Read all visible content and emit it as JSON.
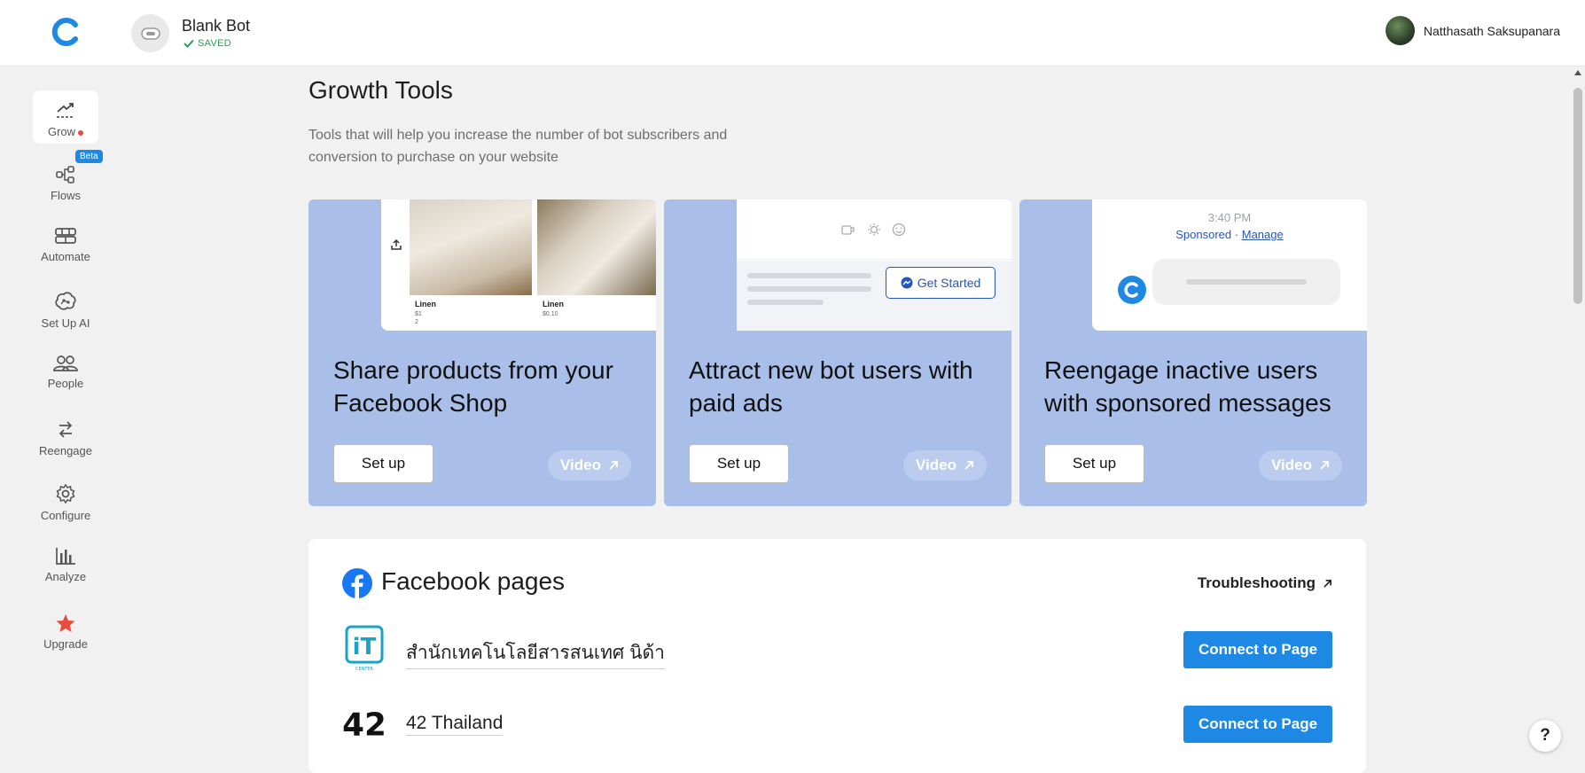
{
  "header": {
    "bot_name": "Blank Bot",
    "bot_status": "SAVED",
    "user_name": "Natthasath Saksupanara"
  },
  "sidebar": {
    "items": [
      {
        "label": "Grow",
        "icon": "trend-icon",
        "active": true
      },
      {
        "label": "Flows",
        "icon": "flows-icon",
        "badge": "Beta"
      },
      {
        "label": "Automate",
        "icon": "automate-icon"
      },
      {
        "label": "Set Up AI",
        "icon": "ai-brain-icon"
      },
      {
        "label": "People",
        "icon": "people-icon"
      },
      {
        "label": "Reengage",
        "icon": "reengage-icon"
      },
      {
        "label": "Configure",
        "icon": "gear-icon"
      },
      {
        "label": "Analyze",
        "icon": "bar-chart-icon"
      },
      {
        "label": "Upgrade",
        "icon": "star-icon"
      }
    ]
  },
  "main": {
    "title": "Growth Tools",
    "subtitle": "Tools that will help you increase the number of bot subscribers and conversion to purchase on your website"
  },
  "cards": [
    {
      "heading": "Share products from your Facebook Shop",
      "setup_label": "Set up",
      "video_label": "Video",
      "preview": {
        "product1": "Linen",
        "price1": "$1",
        "qty1": "2",
        "product2": "Linen",
        "price2": "$0.10"
      }
    },
    {
      "heading": "Attract new bot users with paid ads",
      "setup_label": "Set up",
      "video_label": "Video",
      "preview": {
        "button": "Get Started"
      }
    },
    {
      "heading": "Reengage inactive users with sponsored messages",
      "setup_label": "Set up",
      "video_label": "Video",
      "preview": {
        "time": "3:40 PM",
        "sponsored": "Sponsored",
        "separator": "·",
        "manage": "Manage"
      }
    }
  ],
  "facebook": {
    "title": "Facebook pages",
    "troubleshooting": "Troubleshooting",
    "pages": [
      {
        "name": "สำนักเทคโนโลยีสารสนเทศ นิด้า",
        "logo_text": "iT",
        "logo_sub": "CENTER",
        "button": "Connect to Page"
      },
      {
        "name": "42 Thailand",
        "logo_text": "42",
        "button": "Connect to Page"
      }
    ]
  },
  "help": "?",
  "colors": {
    "accent": "#1e88e5",
    "card_bg": "#a9bfe9",
    "saved": "#2e9b5b",
    "upgrade_star": "#e94c3d"
  }
}
